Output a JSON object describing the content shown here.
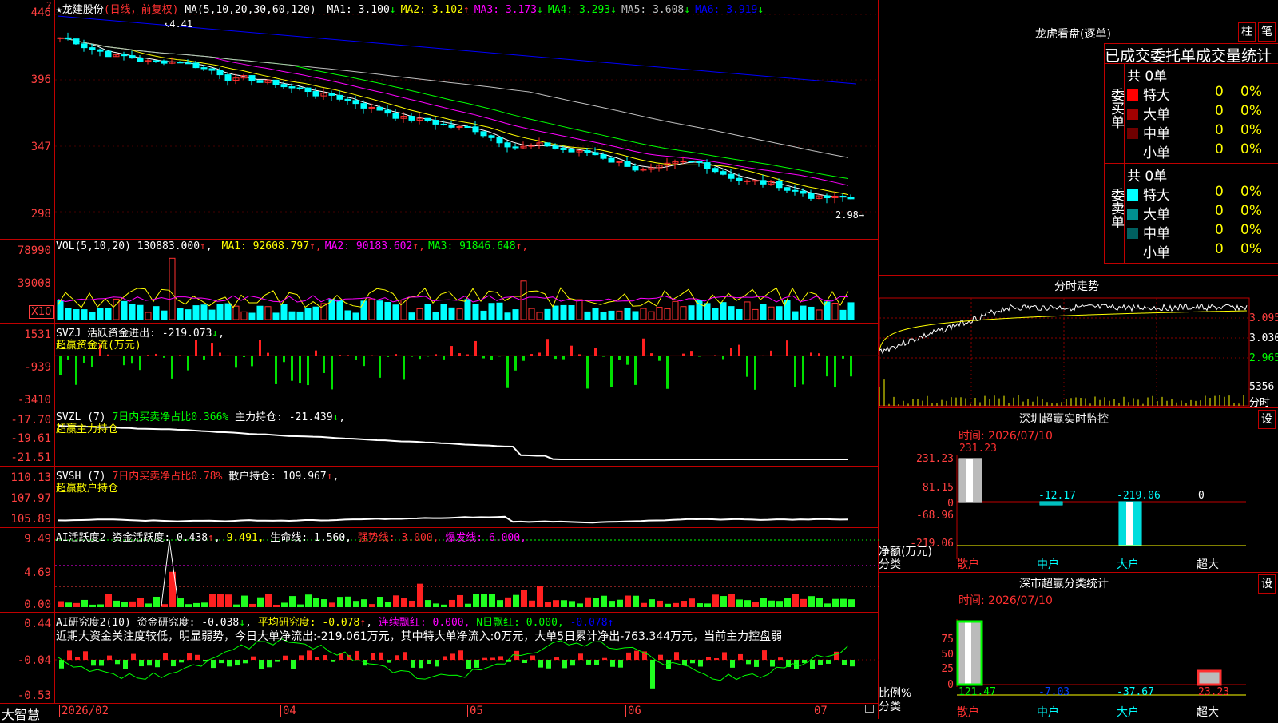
{
  "main": {
    "title": "★龙建股份",
    "period": "(日线，前复权)",
    "ma_label": "MA(5,10,20,30,60,120)",
    "ma_items": [
      {
        "label": "MA1: 3.100",
        "arrow": "↓",
        "color": "#ffffff"
      },
      {
        "label": "MA2: 3.102",
        "arrow": "↑",
        "color": "#ffff00"
      },
      {
        "label": "MA3: 3.173",
        "arrow": "↓",
        "color": "#ff00ff"
      },
      {
        "label": "MA4: 3.293",
        "arrow": "↓",
        "color": "#00ff00"
      },
      {
        "label": "MA5: 3.608",
        "arrow": "↓",
        "color": "#c0c0c0"
      },
      {
        "label": "MA6: 3.919",
        "arrow": "↓",
        "color": "#0000ff"
      }
    ],
    "high_mark": "4.41",
    "low_mark": "2.98",
    "y_ticks": [
      "446",
      "396",
      "347",
      "298"
    ]
  },
  "vol": {
    "label": "VOL(5,10,20)",
    "value": "130883.000",
    "items": [
      {
        "label": "MA1: 92608.797",
        "color": "#ffff00"
      },
      {
        "label": "MA2: 90183.602",
        "color": "#ff00ff"
      },
      {
        "label": "MA3: 91846.648",
        "color": "#00ff00"
      }
    ],
    "y_ticks": [
      "78990",
      "39008"
    ],
    "unit": "X10"
  },
  "svzj": {
    "label": "SVZJ  活跃资金进出:",
    "value": "-219.073",
    "sub": "超赢资金流(万元)",
    "y_ticks": [
      "1531",
      "-939",
      "-3410"
    ]
  },
  "svzl": {
    "label": "SVZL (7)",
    "ratio": "7日内买卖净占比0.366%",
    "hold": "主力持仓: -21.439",
    "sub": "超赢主力持仓",
    "y_ticks": [
      "-17.70",
      "-19.61",
      "-21.51"
    ]
  },
  "svsh": {
    "label": "SVSH (7)",
    "ratio": "7日内买卖净占比0.78%",
    "hold": "散户持仓: 109.967",
    "sub": "超赢散户持仓",
    "y_ticks": [
      "110.13",
      "107.97",
      "105.89"
    ]
  },
  "ai1": {
    "label": "AI活跃度2",
    "hold": "资金活跃度: 0.438",
    "v2": "9.491,",
    "life": "生命线: 1.560,",
    "strong": "强势线: 3.000,",
    "burst": "爆发线: 6.000,",
    "y_ticks": [
      "9.49",
      "4.69",
      "0.00"
    ]
  },
  "ai2": {
    "label": "AI研究度2(10)",
    "research": "资金研究度: -0.038",
    "avg": "平均研究度: -0.078",
    "cont": "连续飘红: 0.000,",
    "nday": "N日飘红: 0.000,",
    "last": "-0.078",
    "comment": "近期大资金关注度较低，明显弱势，今日大单净流出:-219.061万元，其中特大单净流入:0万元，大单5日累计净出-763.344万元，当前主力控盘弱",
    "y_ticks": [
      "0.44",
      "-0.04",
      "-0.53"
    ]
  },
  "xaxis": {
    "brand": "大智慧",
    "labels": [
      "2026/02",
      "04",
      "05",
      "06",
      "07"
    ]
  },
  "lhb": {
    "title": "龙虎看盘(逐单)",
    "btn1": "柱",
    "btn2": "笔",
    "header": "已成交委托单成交量统计",
    "buy_label": "委买单",
    "sell_label": "委卖单",
    "buy_total": "共 0单",
    "sell_total": "共 0单",
    "buy_rows": [
      {
        "name": "特大",
        "count": "0",
        "pct": "0%",
        "color": "#ff0000"
      },
      {
        "name": "大单",
        "count": "0",
        "pct": "0%",
        "color": "#a00000"
      },
      {
        "name": "中单",
        "count": "0",
        "pct": "0%",
        "color": "#700000"
      },
      {
        "name": "小单",
        "count": "0",
        "pct": "0%",
        "color": ""
      }
    ],
    "sell_rows": [
      {
        "name": "特大",
        "count": "0",
        "pct": "0%",
        "color": "#00ffff"
      },
      {
        "name": "大单",
        "count": "0",
        "pct": "0%",
        "color": "#009090"
      },
      {
        "name": "中单",
        "count": "0",
        "pct": "0%",
        "color": "#006060"
      },
      {
        "name": "小单",
        "count": "0",
        "pct": "0%",
        "color": ""
      }
    ]
  },
  "fenshi": {
    "title": "分时走势",
    "y_ticks": [
      "3.095",
      "3.030",
      "2.965"
    ],
    "vol_tick": "5356",
    "vol_label": "分时"
  },
  "szjk": {
    "title": "深圳超赢实时监控",
    "btn": "设",
    "time": "时间: 2026/07/10",
    "y_ticks": [
      "231.23",
      "81.15",
      "0",
      "-68.96",
      "-219.06"
    ],
    "unit": "净额(万元)",
    "cat_label": "分类",
    "values": [
      "231.23",
      "-12.17",
      "-219.06",
      "0"
    ],
    "cats": [
      "散户",
      "中户",
      "大户",
      "超大"
    ]
  },
  "sstj": {
    "title": "深市超赢分类统计",
    "btn": "设",
    "time": "时间: 2026/07/10",
    "y_ticks": [
      "75",
      "50",
      "25",
      "0"
    ],
    "unit": "比例%",
    "cat_label": "分类",
    "values": [
      "121.47",
      "-7.03",
      "-37.67",
      "23.23"
    ],
    "cats": [
      "散户",
      "中户",
      "大户",
      "超大"
    ]
  }
}
